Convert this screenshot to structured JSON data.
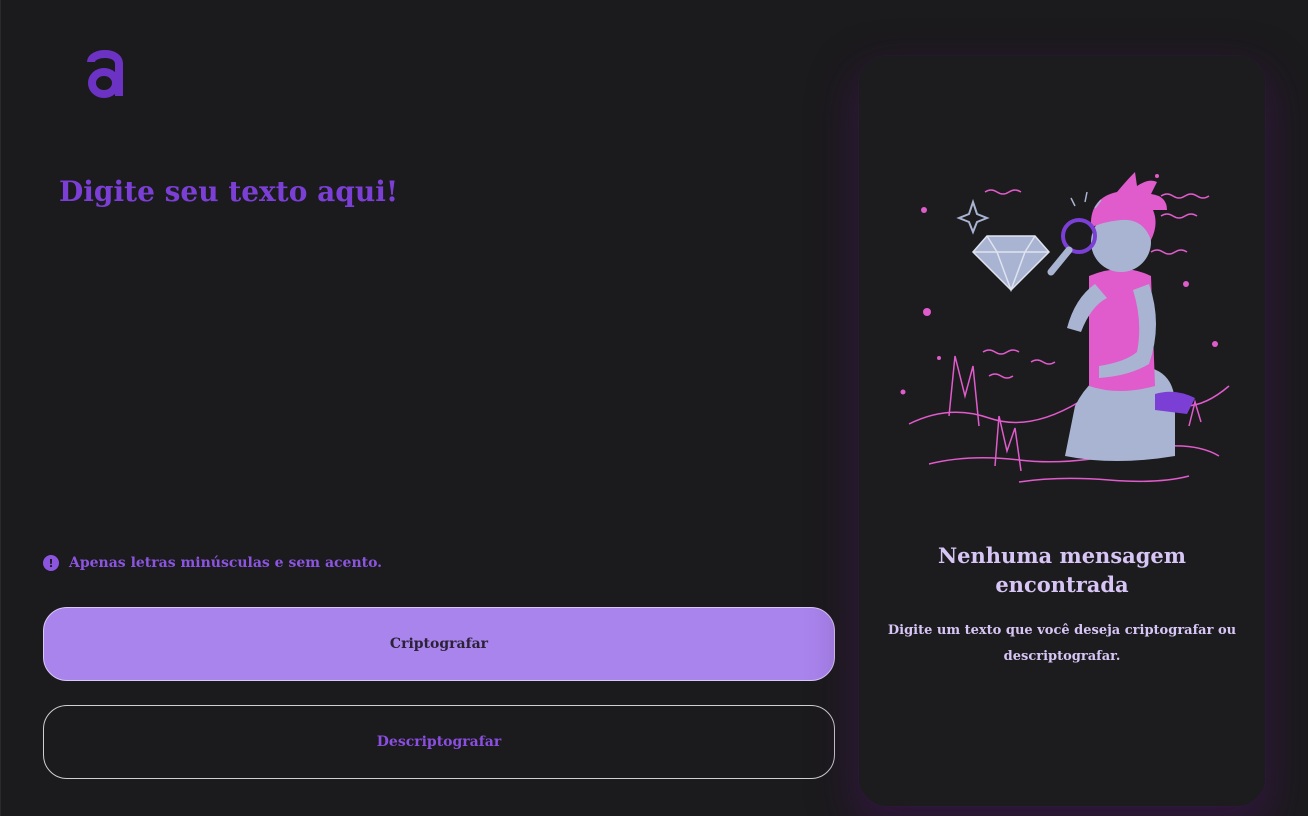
{
  "app": {
    "logo": "a"
  },
  "editor": {
    "placeholder": "Digite seu texto aqui!",
    "value": ""
  },
  "hint": {
    "icon": "exclamation-icon",
    "text": "Apenas letras minúsculas e sem acento."
  },
  "actions": {
    "encrypt_label": "Criptografar",
    "decrypt_label": "Descriptografar"
  },
  "result": {
    "title": "Nenhuma mensagem encontrada",
    "description": "Digite um texto que você deseja criptografar ou descriptografar."
  },
  "colors": {
    "background": "#1b1a1c",
    "accent": "#7b3fd6",
    "button_primary": "#a984ec",
    "illustration_pink": "#e05bcb",
    "illustration_skin": "#a9b4d2"
  }
}
